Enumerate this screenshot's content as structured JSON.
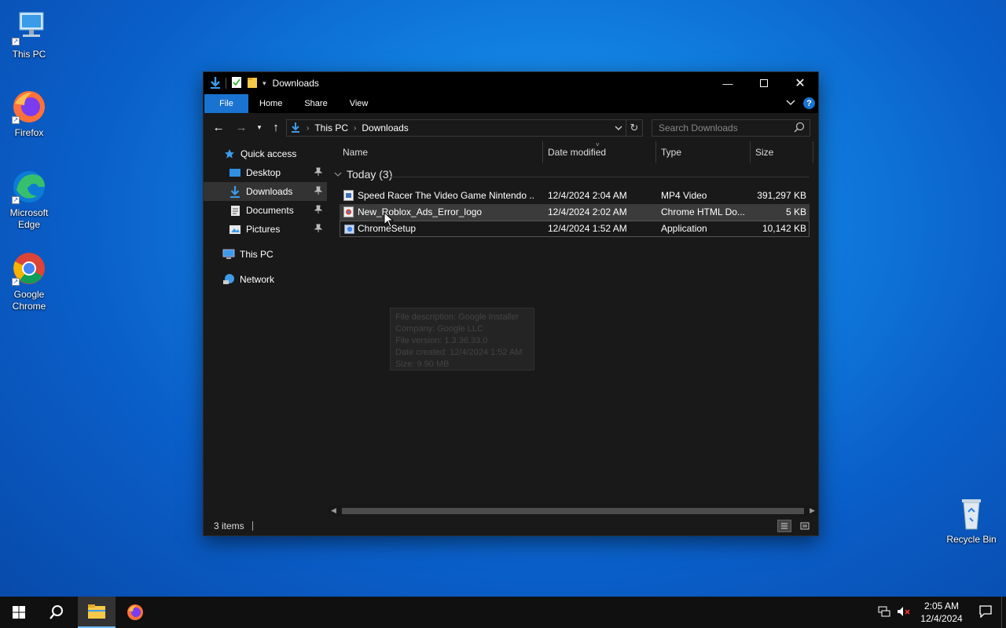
{
  "desktop": {
    "icons": [
      {
        "label": "This PC"
      },
      {
        "label": "Firefox"
      },
      {
        "label": "Microsoft Edge"
      },
      {
        "label": "Google Chrome"
      },
      {
        "label": "Recycle Bin"
      }
    ]
  },
  "window": {
    "title": "Downloads",
    "ribbon_tabs": [
      "File",
      "Home",
      "Share",
      "View"
    ],
    "breadcrumb": [
      "This PC",
      "Downloads"
    ],
    "search_placeholder": "Search Downloads",
    "nav": {
      "quick_access": "Quick access",
      "desktop": "Desktop",
      "downloads": "Downloads",
      "documents": "Documents",
      "pictures": "Pictures",
      "this_pc": "This PC",
      "network": "Network"
    },
    "columns": {
      "name": "Name",
      "date": "Date modified",
      "type": "Type",
      "size": "Size"
    },
    "group": "Today (3)",
    "files": [
      {
        "name": "Speed Racer The Video Game Nintendo ...",
        "date": "12/4/2024 2:04 AM",
        "type": "MP4 Video",
        "size": "391,297 KB"
      },
      {
        "name": "New_Roblox_Ads_Error_logo",
        "date": "12/4/2024 2:02 AM",
        "type": "Chrome HTML Do...",
        "size": "5 KB"
      },
      {
        "name": "ChromeSetup",
        "date": "12/4/2024 1:52 AM",
        "type": "Application",
        "size": "10,142 KB"
      }
    ],
    "tooltip": [
      "File description: Google Installer",
      "Company: Google LLC",
      "File version: 1.3.36.33.0",
      "Date created: 12/4/2024 1:52 AM",
      "Size: 9.90 MB"
    ],
    "status": "3 items"
  },
  "taskbar": {
    "time": "2:05 AM",
    "date": "12/4/2024"
  }
}
